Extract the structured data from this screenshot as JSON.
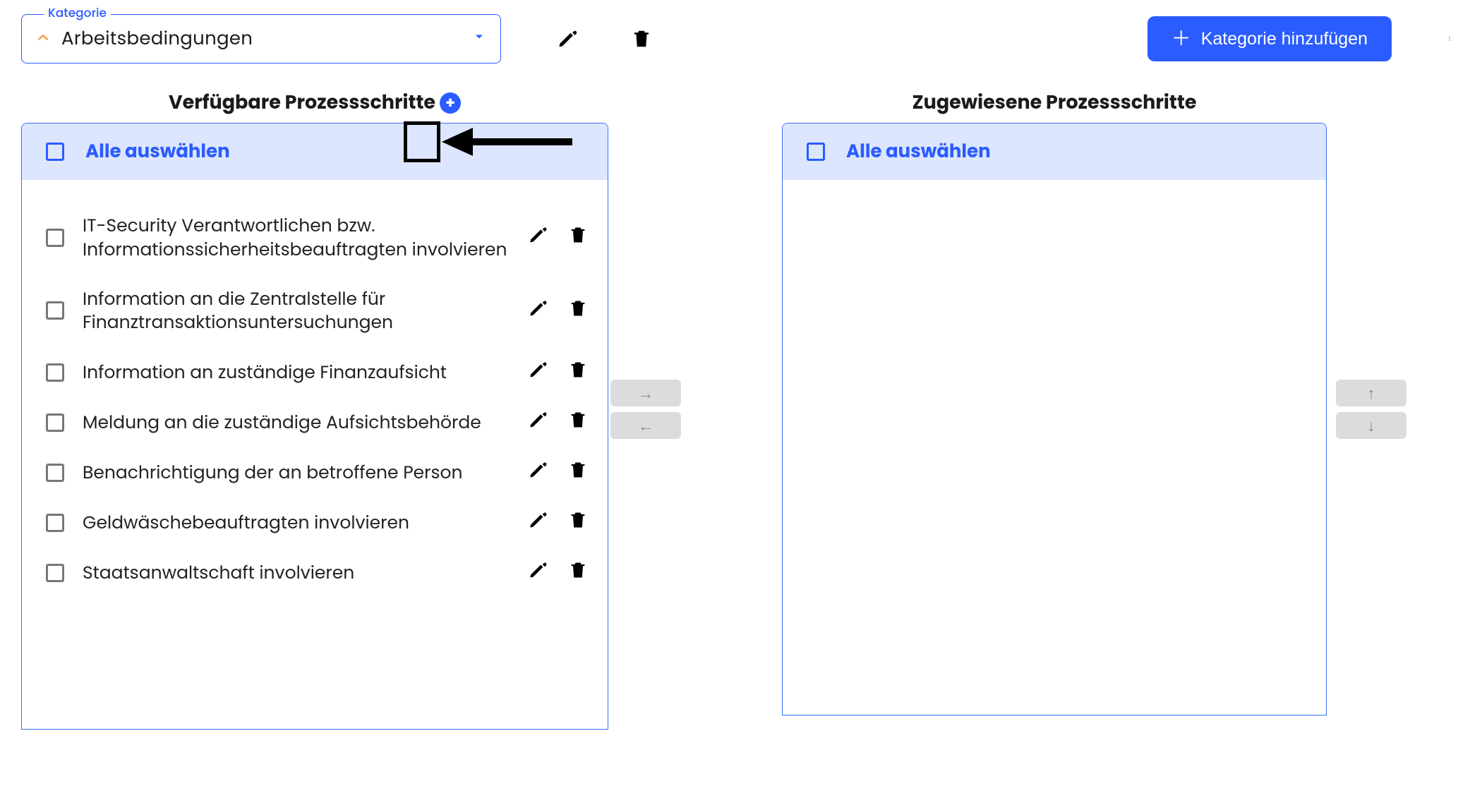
{
  "top": {
    "category_legend": "Kategorie",
    "category_value": "Arbeitsbedingungen",
    "add_category_label": "Kategorie hinzufügen"
  },
  "available": {
    "header": "Verfügbare Prozessschritte",
    "select_all": "Alle auswählen",
    "items": [
      "IT-Security Verantwortlichen bzw. Informationssicherheitsbeauftragten involvieren",
      "Information an die Zentralstelle für Finanztransaktionsuntersuchungen",
      "Information an zuständige Finanzaufsicht",
      "Meldung an die zuständige Aufsichtsbehörde",
      "Benachrichtigung der an betroffene Person",
      "Geldwäschebeauftragten involvieren",
      "Staatsanwaltschaft involvieren"
    ]
  },
  "assigned": {
    "header": "Zugewiesene Prozessschritte",
    "select_all": "Alle auswählen"
  },
  "controls": {
    "move_right": "→",
    "move_left": "←",
    "move_up": "↑",
    "move_down": "↓"
  }
}
